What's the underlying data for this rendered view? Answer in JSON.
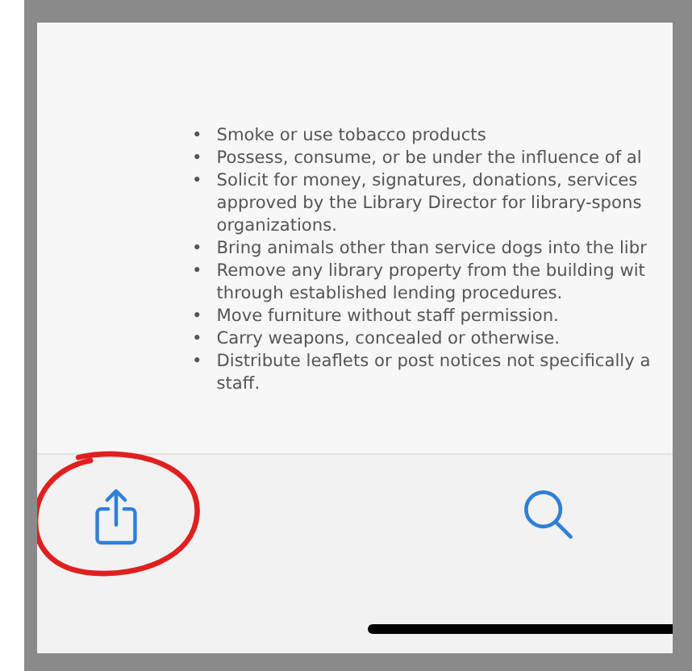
{
  "document": {
    "items": [
      {
        "marker": "•",
        "lines": [
          "Smoke or use tobacco products"
        ]
      },
      {
        "marker": "•",
        "lines": [
          "Possess, consume, or be under the influence of al"
        ]
      },
      {
        "marker": "•",
        "lines": [
          "Solicit for money, signatures, donations, services",
          "approved by the Library Director for library-spons",
          "organizations."
        ]
      },
      {
        "marker": "•",
        "lines": [
          "Bring animals other than service dogs into the libr"
        ]
      },
      {
        "marker": "•",
        "lines": [
          "Remove any library property from the building wit",
          "through established lending procedures."
        ]
      },
      {
        "marker": "•",
        "lines": [
          "Move furniture without staff permission."
        ]
      },
      {
        "marker": "•",
        "lines": [
          "Carry weapons, concealed or otherwise."
        ]
      },
      {
        "marker": "•",
        "lines": [
          "Distribute leaflets or post notices not specifically a",
          "staff."
        ]
      }
    ]
  },
  "toolbar": {
    "buttons": [
      {
        "kind": "share",
        "circled": true
      },
      {
        "kind": "search",
        "circled": false
      }
    ]
  }
}
